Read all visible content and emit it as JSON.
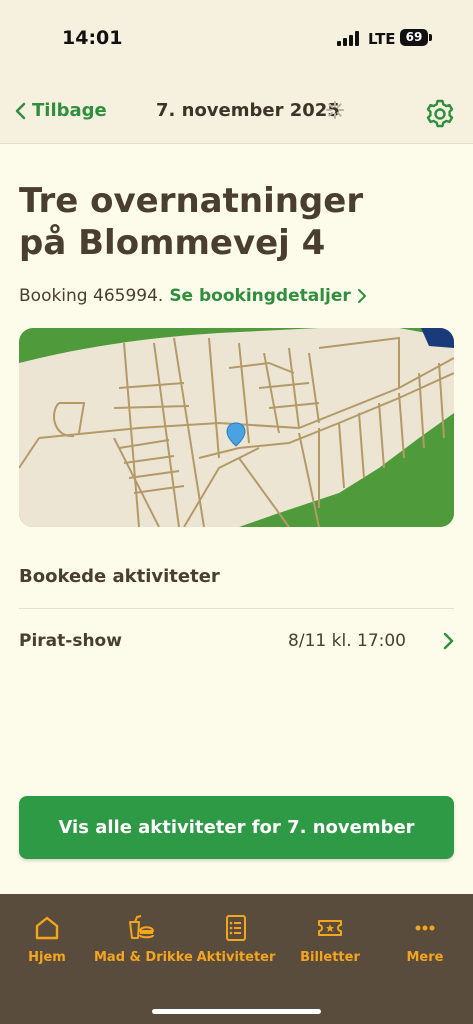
{
  "status_bar": {
    "time": "14:01",
    "network": "LTE",
    "battery": "69"
  },
  "header": {
    "back_label": "Tilbage",
    "date": "7. november 2025"
  },
  "page": {
    "title_line1": "Tre overnatninger",
    "title_line2": "på Blommevej 4",
    "booking_text": "Booking 465994.",
    "booking_link": "Se bookingdetaljer"
  },
  "activities": {
    "section_title": "Bookede aktiviteter",
    "items": [
      {
        "name": "Pirat-show",
        "time": "8/11 kl. 17:00"
      }
    ]
  },
  "primary_button": {
    "label": "Vis alle aktiviteter for 7. november"
  },
  "tabs": [
    {
      "label": "Hjem",
      "icon": "home-icon"
    },
    {
      "label": "Mad & Drikke",
      "icon": "food-icon"
    },
    {
      "label": "Aktiviteter",
      "icon": "activities-icon"
    },
    {
      "label": "Billetter",
      "icon": "ticket-icon"
    },
    {
      "label": "Mere",
      "icon": "more-icon"
    }
  ],
  "colors": {
    "accent": "#2f9a45",
    "background": "#fdfbe9",
    "tabbar": "#5a4c3c",
    "tab_icon": "#f3a51e",
    "text": "#4a3e31"
  }
}
